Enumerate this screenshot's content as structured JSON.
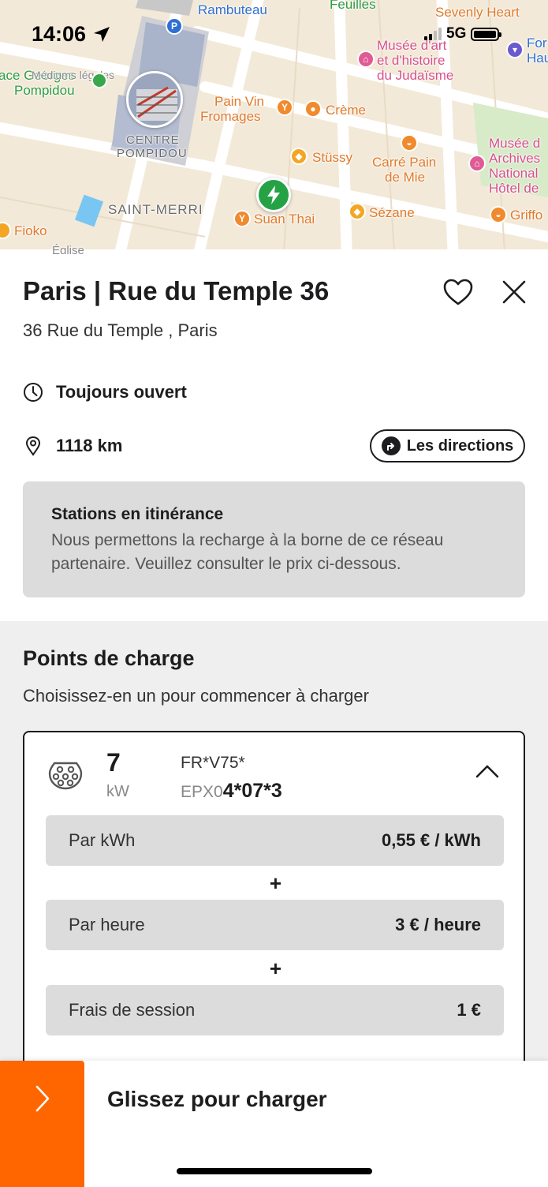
{
  "status_bar": {
    "time": "14:06",
    "network": "5G"
  },
  "map": {
    "labels": {
      "rambuteau": "Rambuteau",
      "feuilles": "Feuilles",
      "sevenly": "Sevenly Heart",
      "musee_art1": "Musée d'art",
      "musee_art2": "et d'histoire",
      "musee_art3": "du Judaïsme",
      "fon1": "For",
      "fon2": "Hau",
      "georges1": "ace Georges",
      "georges_over": "Médiums légales",
      "georges2": "Pompidou",
      "pain_vin1": "Pain Vin",
      "pain_vin2": "Fromages",
      "creme": "Crème",
      "centre1": "CENTRE",
      "centre2": "POMPIDOU",
      "stussy": "Stüssy",
      "carre1": "Carré Pain",
      "carre2": "de Mie",
      "archives1": "Musée d",
      "archives2": "Archives",
      "archives3": "National",
      "archives4": "Hôtel de",
      "saint_merri": "SAINT-MERRI",
      "suan_thai": "Suan Thai",
      "sezane": "Sézane",
      "griffo": "Griffo",
      "fioko": "Fioko",
      "eglise": "Église"
    }
  },
  "station": {
    "title": "Paris | Rue du Temple 36",
    "address": "36 Rue du Temple , Paris",
    "hours": "Toujours ouvert",
    "distance": "1118 km",
    "directions_label": "Les directions",
    "roaming_title": "Stations en itinérance",
    "roaming_text": "Nous permettons la recharge à la borne de ce réseau partenaire. Veuillez consulter le prix ci-dessous."
  },
  "charge_points": {
    "title": "Points de charge",
    "subtitle": "Choisissez-en un pour commencer à charger",
    "items": [
      {
        "power": "7",
        "unit": "kW",
        "evse_line1": "FR*V75*",
        "evse_prefix": "EPX0",
        "evse_suffix": "4*07*3",
        "prices": [
          {
            "label": "Par kWh",
            "value": "0,55 € / kWh"
          },
          {
            "label": "Par heure",
            "value": "3 € / heure"
          },
          {
            "label": "Frais de session",
            "value": "1 €"
          }
        ],
        "separator": "+"
      }
    ]
  },
  "slider": {
    "label": "Glissez pour charger"
  },
  "colors": {
    "accent": "#ff6600",
    "charger_green": "#25a244",
    "panel_gray": "#dcdcdc"
  }
}
